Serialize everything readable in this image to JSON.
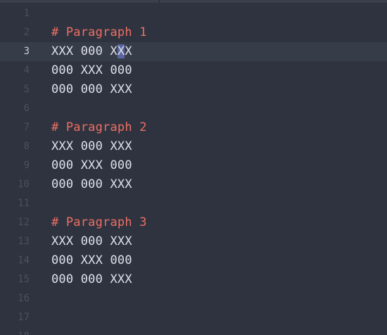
{
  "editor": {
    "current_line": 3,
    "lines": [
      {
        "num": "1",
        "text": ""
      },
      {
        "num": "2",
        "text": "# Paragraph 1"
      },
      {
        "num": "3",
        "text_before": "XXX 000 X",
        "text_selected": "X",
        "text_after": "X"
      },
      {
        "num": "4",
        "text": "000 XXX 000"
      },
      {
        "num": "5",
        "text": "000 000 XXX"
      },
      {
        "num": "6",
        "text": ""
      },
      {
        "num": "7",
        "text": "# Paragraph 2"
      },
      {
        "num": "8",
        "text": "XXX 000 XXX"
      },
      {
        "num": "9",
        "text": "000 XXX 000"
      },
      {
        "num": "10",
        "text": "000 000 XXX"
      },
      {
        "num": "11",
        "text": ""
      },
      {
        "num": "12",
        "text": "# Paragraph 3"
      },
      {
        "num": "13",
        "text": "XXX 000 XXX"
      },
      {
        "num": "14",
        "text": "000 XXX 000"
      },
      {
        "num": "15",
        "text": "000 000 XXX"
      },
      {
        "num": "16",
        "text": ""
      },
      {
        "num": "17",
        "text": ""
      },
      {
        "num": "18",
        "text": ""
      }
    ]
  },
  "colors": {
    "background": "#2f333f",
    "heading": "#ee6f64",
    "text": "#dde1ea",
    "line_number": "#4a505e",
    "active_line": "#373c49",
    "selection": "#5a66a0"
  }
}
